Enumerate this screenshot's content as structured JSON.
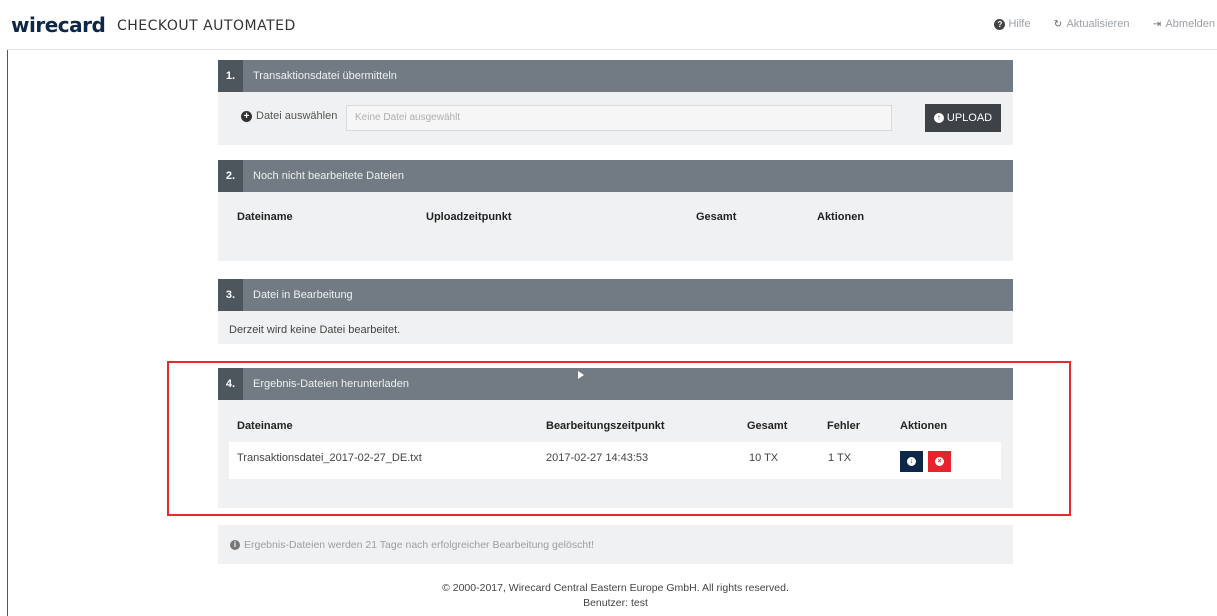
{
  "header": {
    "logo": "wirecard",
    "title": "CHECKOUT AUTOMATED",
    "nav": [
      {
        "label": "Hilfe",
        "icon": "help-icon"
      },
      {
        "label": "Aktualisieren",
        "icon": "refresh-icon"
      },
      {
        "label": "Abmelden",
        "icon": "logout-icon"
      }
    ]
  },
  "panel1": {
    "number": "1.",
    "title": "Transaktionsdatei übermitteln",
    "choose_label": "Datei auswählen",
    "file_placeholder": "Keine Datei ausgewählt",
    "upload_label": "UPLOAD"
  },
  "panel2": {
    "number": "2.",
    "title": "Noch nicht bearbeitete Dateien",
    "columns": [
      "Dateiname",
      "Uploadzeitpunkt",
      "Gesamt",
      "Aktionen"
    ]
  },
  "panel3": {
    "number": "3.",
    "title": "Datei in Bearbeitung",
    "message": "Derzeit wird keine Datei bearbeitet."
  },
  "panel4": {
    "number": "4.",
    "title": "Ergebnis-Dateien herunterladen",
    "columns": [
      "Dateiname",
      "Bearbeitungszeitpunkt",
      "Gesamt",
      "Fehler",
      "Aktionen"
    ],
    "rows": [
      {
        "filename": "Transaktionsdatei_2017-02-27_DE.txt",
        "timestamp": "2017-02-27 14:43:53",
        "total": "10 TX",
        "errors": "1 TX"
      }
    ]
  },
  "info": {
    "text": "Ergebnis-Dateien werden 21 Tage nach erfolgreicher Bearbeitung gelöscht!"
  },
  "footer": {
    "copyright": "© 2000-2017, Wirecard Central Eastern Europe GmbH. All rights reserved.",
    "user": "Benutzer: test"
  },
  "colors": {
    "brand_navy": "#0d2748",
    "panel_header": "#727b83",
    "highlight": "#e32b2b",
    "delete": "#e8232d"
  }
}
